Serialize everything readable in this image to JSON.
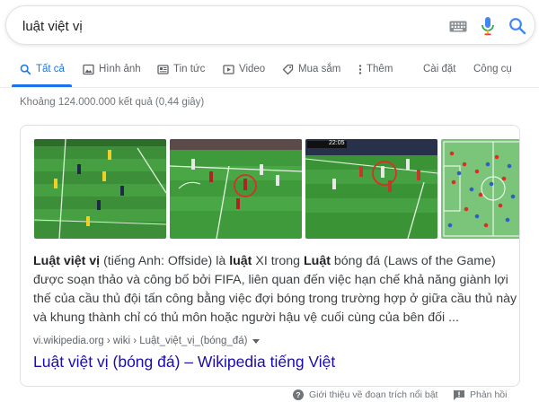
{
  "search": {
    "query": "luật việt vị"
  },
  "tabs": [
    {
      "label": "Tất cả",
      "icon": "search-icon",
      "active": true
    },
    {
      "label": "Hình ảnh",
      "icon": "image-icon"
    },
    {
      "label": "Tin tức",
      "icon": "news-icon"
    },
    {
      "label": "Video",
      "icon": "video-icon"
    },
    {
      "label": "Mua sắm",
      "icon": "tag-icon"
    },
    {
      "label": "Thêm",
      "icon": "more-vert-icon"
    },
    {
      "label": "Cài đặt"
    },
    {
      "label": "Công cụ"
    }
  ],
  "result_stats": "Khoảng 124.000.000 kết quả (0,44 giây)",
  "snippet": {
    "line1": {
      "b1": "Luật việt vị",
      "t1": " (tiếng Anh: Offside) là ",
      "b2": "luật",
      "t2": " XI trong ",
      "b3": "Luật",
      "t3": " bóng đá (Laws of the Game)"
    },
    "line2": "được soạn thảo và công bố bởi FIFA, liên quan đến việc hạn chế khả năng giành lợi",
    "line3": "thế của cầu thủ đội tấn công bằng việc đợi bóng trong trường hợp ở giữa cầu thủ này",
    "line4": "và khung thành chỉ có thủ môn hoặc người hậu vệ cuối cùng của bên đối ...",
    "cite": "vi.wikipedia.org › wiki › Luật_việt_vị_(bóng_đá)",
    "link_title": "Luật việt vị (bóng đá) – Wikipedia tiếng Việt"
  },
  "thumbnails": [
    {
      "name": "offside-thumbnail-1"
    },
    {
      "name": "offside-thumbnail-2"
    },
    {
      "name": "offside-thumbnail-3",
      "scoreboard": "22:05"
    },
    {
      "name": "offside-thumbnail-4"
    }
  ],
  "footer": {
    "about_label": "Giới thiệu về đoạn trích nổi bật",
    "feedback_label": "Phản hồi"
  },
  "colors": {
    "accent": "#1a73e8",
    "link": "#1a0dab",
    "pitch": "#3f9a3b"
  }
}
